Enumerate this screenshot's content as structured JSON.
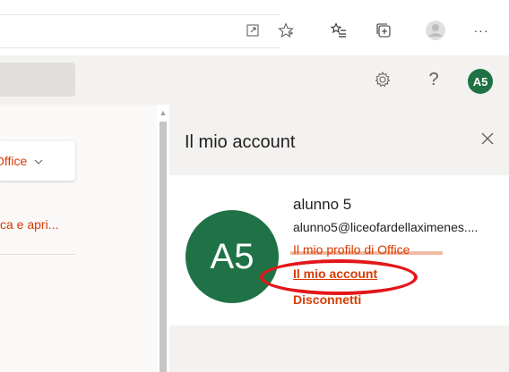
{
  "browser": {
    "icons": [
      "open-tab-icon",
      "favorite-star-icon",
      "favorites-list-icon",
      "collections-icon",
      "profile-icon",
      "more-icon"
    ],
    "more_label": "···"
  },
  "header": {
    "help_label": "?",
    "avatar_initials": "A5"
  },
  "left": {
    "office_label": "Office",
    "link_label": "ca e apri..."
  },
  "panel": {
    "title": "Il mio account",
    "avatar_initials": "A5",
    "user_name": "alunno 5",
    "user_email": "alunno5@liceofardellaximenes....",
    "profile_link": "Il mio profilo di Office",
    "account_link": "Il mio account",
    "signout_link": "Disconnetti"
  },
  "colors": {
    "accent": "#d83b01",
    "avatar": "#1f7245",
    "highlight": "#e3161b"
  }
}
